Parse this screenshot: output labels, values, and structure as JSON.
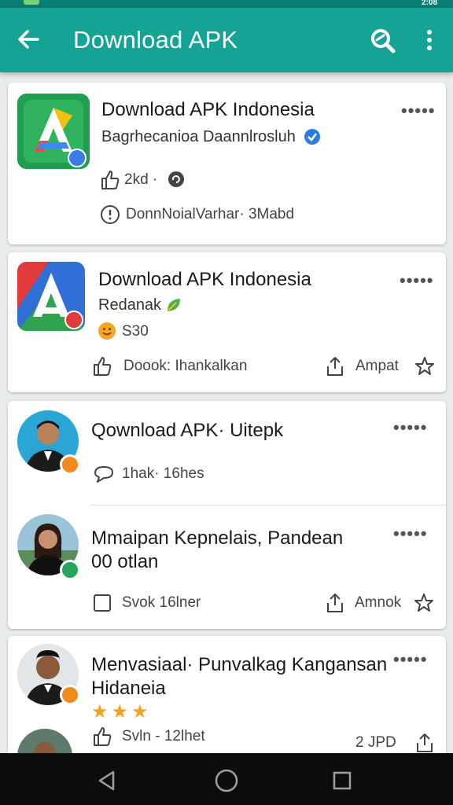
{
  "appbar": {
    "title": "Download APK",
    "back_icon": "arrow-left-icon",
    "search_icon": "search-icon",
    "menu_icon": "more-vert-icon"
  },
  "colors": {
    "appbar": "#14a395",
    "statusbar": "#0a7f74",
    "background": "#e9ecec",
    "card": "#ffffff",
    "star": "#f2a21b",
    "navbar": "#0d0d0d"
  },
  "feed": [
    {
      "title": "Download APK Indonesia",
      "subtitle": "Bagrhecanioa Daannlrosluh",
      "verified_icon": "verified-check-icon",
      "stat": "2kd ·",
      "info": "DonnNoialVarhar· 3Mabd",
      "more": "•••••"
    },
    {
      "title": "Download APK Indonesia",
      "subtitle": "Redanak",
      "rating": "S30",
      "action_left": "Doook: Ihankalkan",
      "action_right": "Ampat",
      "more": "•••••"
    },
    {
      "title": "Qownload APK· Uitepk",
      "comments": "1hak· 16hes",
      "more": "•••••"
    },
    {
      "title_line1": "Mmaipan Kepnelais, Pandean",
      "title_line2": "00 otlan",
      "action_left": "Svok 16lner",
      "action_right": "Amnok",
      "more": "•••••"
    },
    {
      "title_line1": "Menvasiaal· Punvalkag Kangansan",
      "title_line2": "Hidaneia",
      "stars": "★★★",
      "action_left": "Svln - 12lhet",
      "action_right": "2 JPD",
      "more": "•••••"
    }
  ],
  "status": {
    "time": "2:08"
  },
  "navbar": {
    "back_icon": "nav-back-icon",
    "home_icon": "nav-home-icon",
    "recents_icon": "nav-recents-icon"
  }
}
